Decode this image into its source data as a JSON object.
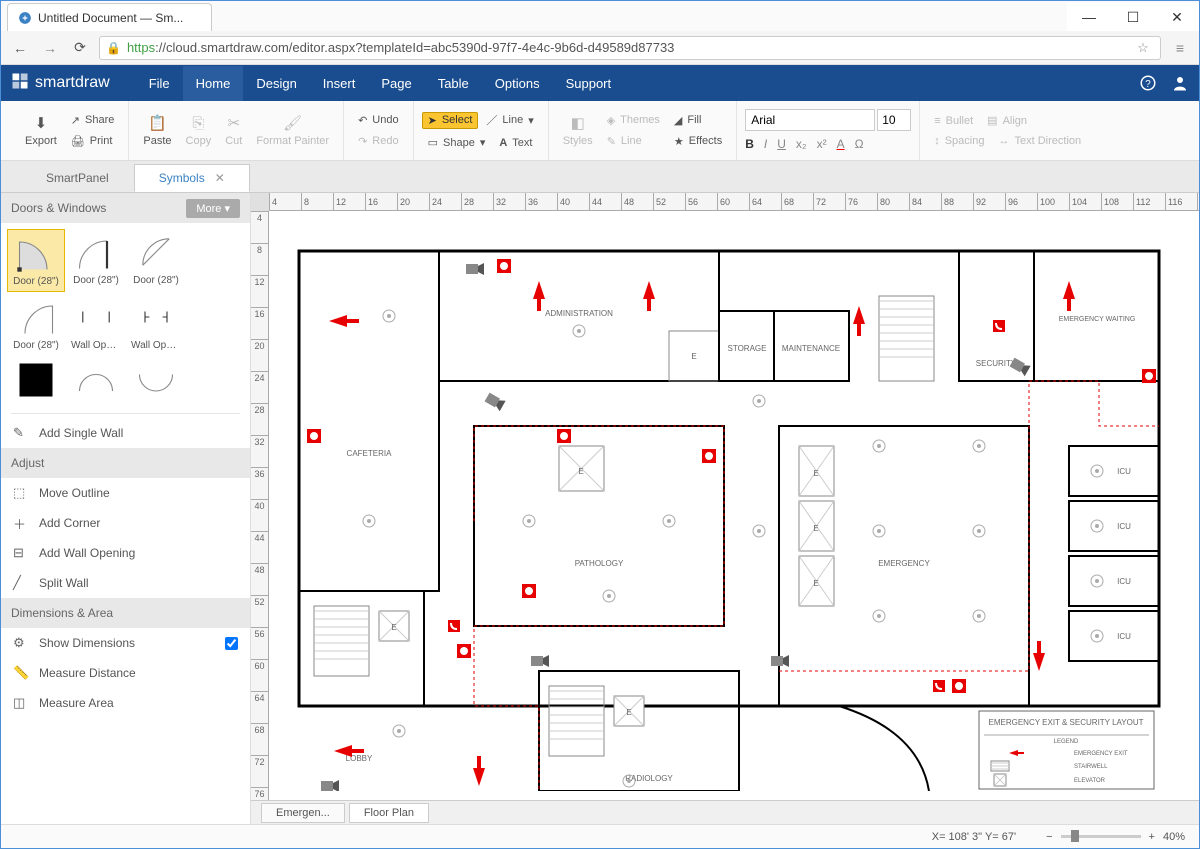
{
  "browser": {
    "tab_title": "Untitled Document — Sm...",
    "url_https": "https",
    "url_rest": "://cloud.smartdraw.com/editor.aspx?templateId=abc5390d-97f7-4e4c-9b6d-d49589d87733"
  },
  "app": {
    "logo": "smartdraw",
    "menu": [
      "File",
      "Home",
      "Design",
      "Insert",
      "Page",
      "Table",
      "Options",
      "Support"
    ],
    "active_menu": "Home"
  },
  "ribbon": {
    "export": "Export",
    "share": "Share",
    "print": "Print",
    "paste": "Paste",
    "copy": "Copy",
    "cut": "Cut",
    "format_painter": "Format Painter",
    "undo": "Undo",
    "redo": "Redo",
    "select": "Select",
    "shape": "Shape",
    "line": "Line",
    "text": "Text",
    "styles": "Styles",
    "themes": "Themes",
    "line2": "Line",
    "fill": "Fill",
    "effects": "Effects",
    "font": "Arial",
    "font_size": "10",
    "bullet": "Bullet",
    "align": "Align",
    "spacing": "Spacing",
    "text_direction": "Text Direction"
  },
  "panel_tabs": {
    "smartpanel": "SmartPanel",
    "symbols": "Symbols"
  },
  "sidebar": {
    "section1": "Doors & Windows",
    "more": "More",
    "symbols": [
      {
        "label": "Door (28\")",
        "selected": true
      },
      {
        "label": "Door (28\")"
      },
      {
        "label": "Door (28\")"
      },
      {
        "label": "Door (28\")"
      },
      {
        "label": "Wall Opening"
      },
      {
        "label": "Wall Openi..."
      }
    ],
    "add_single_wall": "Add Single Wall",
    "adjust": "Adjust",
    "move_outline": "Move Outline",
    "add_corner": "Add Corner",
    "add_wall_opening": "Add Wall Opening",
    "split_wall": "Split Wall",
    "dimensions_area": "Dimensions & Area",
    "show_dimensions": "Show Dimensions",
    "measure_distance": "Measure Distance",
    "measure_area": "Measure Area"
  },
  "floorplan": {
    "rooms": {
      "administration": "ADMINISTRATION",
      "storage": "STORAGE",
      "maintenance": "MAINTENANCE",
      "security": "SECURITY",
      "emergency_waiting": "EMERGENCY WAITING",
      "cafeteria": "CAFETERIA",
      "pathology": "PATHOLOGY",
      "emergency": "EMERGENCY",
      "icu": "ICU",
      "radiology": "RADIOLOGY",
      "lobby": "LOBBY"
    },
    "legend": {
      "title": "EMERGENCY EXIT & SECURITY LAYOUT",
      "hdr": "LEGEND",
      "exit": "EMERGENCY EXIT",
      "stairwell": "STAIRWELL",
      "elevator": "ELEVATOR"
    },
    "elevator_label": "E"
  },
  "bottom": {
    "tab1": "Emergen...",
    "tab2": "Floor Plan",
    "coords": "X= 108' 3\"  Y= 67'",
    "zoom": "40%"
  }
}
